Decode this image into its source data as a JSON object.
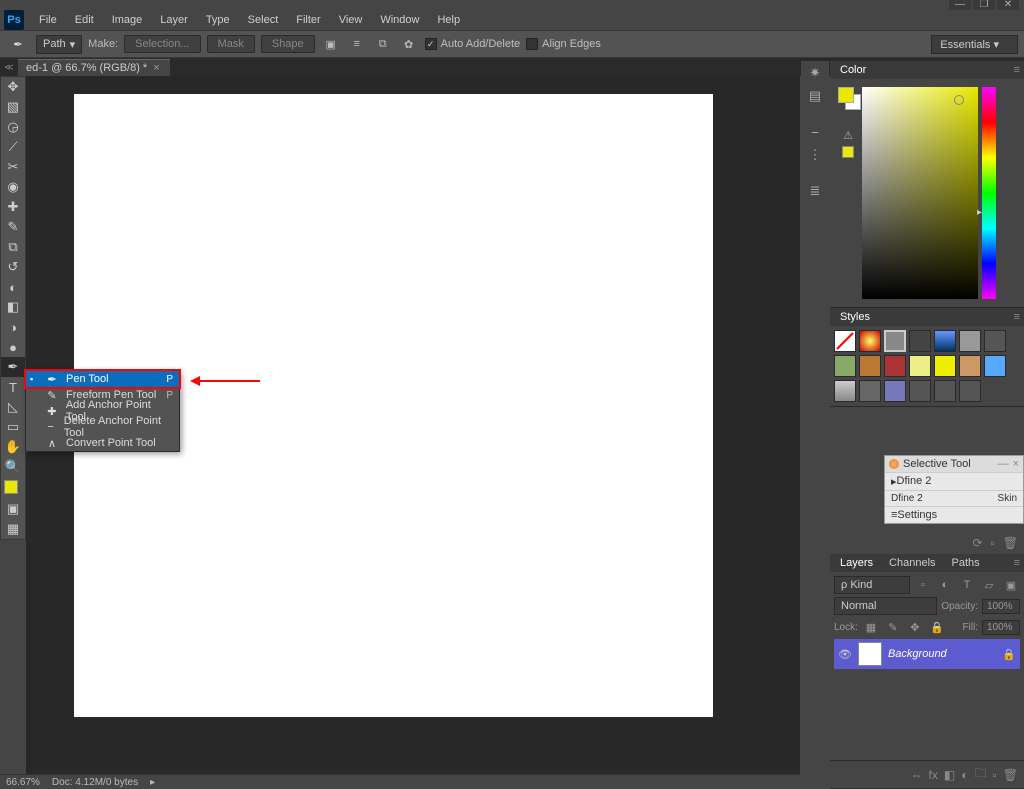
{
  "app": {
    "name": "Ps"
  },
  "window_controls": {
    "min": "—",
    "max": "❐",
    "close": "✕"
  },
  "menus": [
    "File",
    "Edit",
    "Image",
    "Layer",
    "Type",
    "Select",
    "Filter",
    "View",
    "Window",
    "Help"
  ],
  "options_bar": {
    "mode_select": "Path",
    "make_label": "Make:",
    "make_selection": "Selection...",
    "make_mask": "Mask",
    "make_shape": "Shape",
    "auto_add_delete": "Auto Add/Delete",
    "align_edges": "Align Edges",
    "workspace": "Essentials"
  },
  "document_tab": {
    "title": "ed-1 @ 66.7% (RGB/8) *"
  },
  "tools": [
    "↕",
    "▦",
    "◶",
    "⟋",
    "✂",
    "◉",
    "✎",
    "⟋",
    "⧉",
    "⚈",
    "◐",
    "◑",
    "●",
    "✒",
    "T",
    "◺",
    "✋",
    "🔍"
  ],
  "flyout": {
    "items": [
      {
        "label": "Pen Tool",
        "key": "P",
        "selected": true
      },
      {
        "label": "Freeform Pen Tool",
        "key": "P",
        "selected": false
      },
      {
        "label": "Add Anchor Point Tool",
        "key": "",
        "selected": false
      },
      {
        "label": "Delete Anchor Point Tool",
        "key": "",
        "selected": false
      },
      {
        "label": "Convert Point Tool",
        "key": "",
        "selected": false
      }
    ]
  },
  "right_icons": [
    "✷",
    "≡",
    "⎯",
    "⋮",
    "≣"
  ],
  "color_panel": {
    "title": "Color",
    "warn": "⚠"
  },
  "styles_panel": {
    "title": "Styles"
  },
  "selective_tool": {
    "title": "Selective Tool",
    "sub": "Dfine 2",
    "row1a": "Dfine 2",
    "row1b": "Skin",
    "settings": "Settings"
  },
  "layers_panel": {
    "tabs": [
      "Layers",
      "Channels",
      "Paths"
    ],
    "kind_placeholder": "ρ Kind",
    "blend_mode": "Normal",
    "opacity_label": "Opacity:",
    "opacity_value": "100%",
    "lock_label": "Lock:",
    "fill_label": "Fill:",
    "fill_value": "100%",
    "layer_name": "Background"
  },
  "status": {
    "zoom": "66.67%",
    "doc": "Doc: 4.12M/0 bytes"
  }
}
